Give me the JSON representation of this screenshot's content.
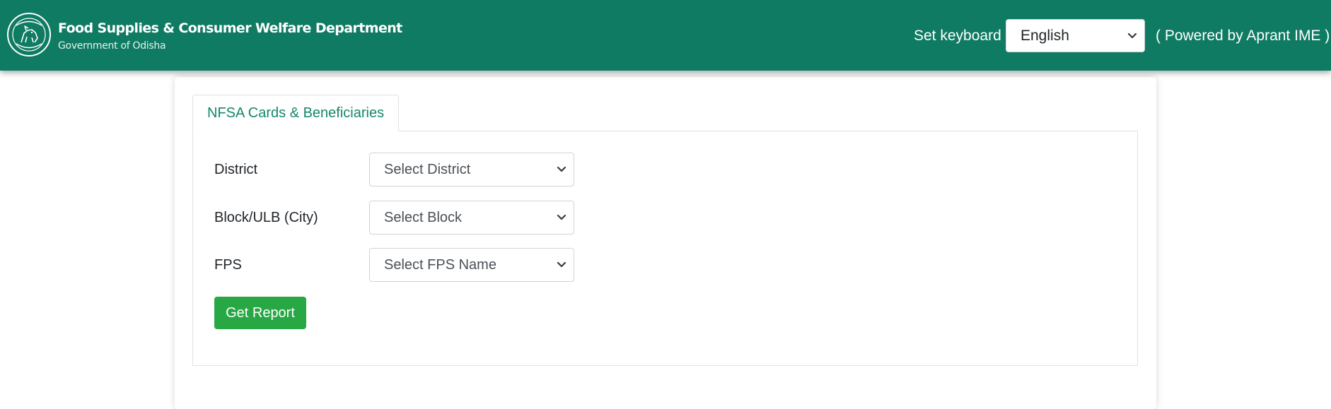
{
  "header": {
    "title": "Food Supplies & Consumer Welfare Department",
    "subtitle": "Government of Odisha",
    "logo_icon": "odisha-emblem-icon",
    "keyboard_label": "Set keyboard",
    "keyboard_selected": "English",
    "powered_by": "( Powered by Aprant IME )"
  },
  "tabs": [
    {
      "label": "NFSA Cards & Beneficiaries",
      "active": true
    }
  ],
  "form": {
    "district_label": "District",
    "district_selected": "Select District",
    "block_label": "Block/ULB (City)",
    "block_selected": "Select Block",
    "fps_label": "FPS",
    "fps_selected": "Select FPS Name",
    "submit_label": "Get Report"
  },
  "colors": {
    "header_bg": "#0f7b63",
    "tab_text": "#12886b",
    "button_bg": "#28a745"
  }
}
